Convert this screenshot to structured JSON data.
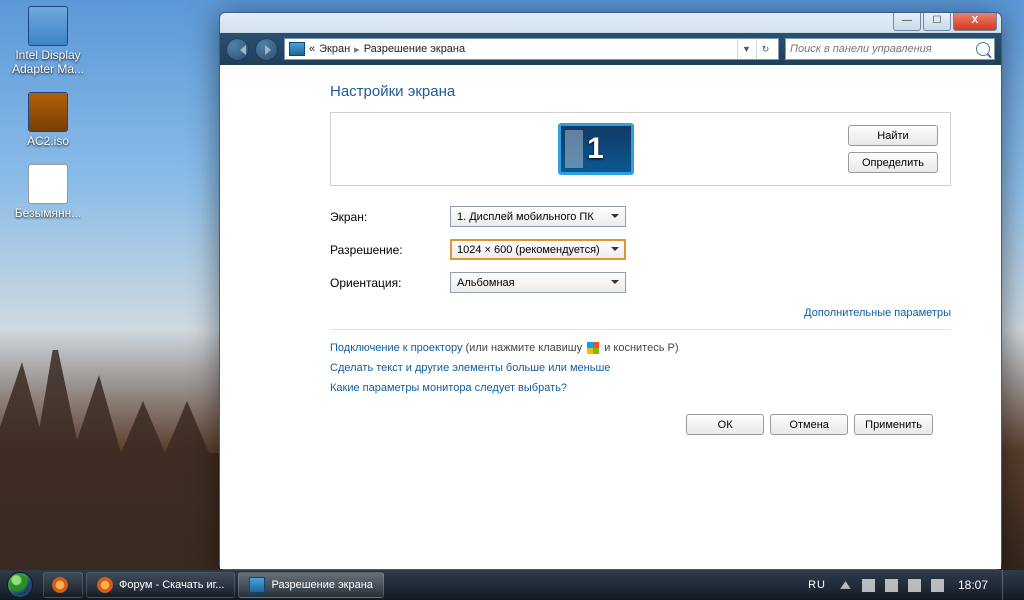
{
  "desktop": {
    "icons": [
      {
        "label": "Intel Display Adapter Ma..."
      },
      {
        "label": "AC2.iso"
      },
      {
        "label": "Безымянн..."
      }
    ]
  },
  "window": {
    "breadcrumb": {
      "part1": "Экран",
      "part2": "Разрешение экрана"
    },
    "search_placeholder": "Поиск в панели управления",
    "heading": "Настройки экрана",
    "buttons": {
      "find": "Найти",
      "identify": "Определить"
    },
    "monitor_number": "1",
    "fields": {
      "screen_label": "Экран:",
      "screen_value": "1. Дисплей мобильного ПК",
      "resolution_label": "Разрешение:",
      "resolution_value": "1024 × 600 (рекомендуется)",
      "orientation_label": "Ориентация:",
      "orientation_value": "Альбомная"
    },
    "advanced_link": "Дополнительные параметры",
    "projector_link": "Подключение к проектору",
    "projector_hint_a": " (или нажмите клавишу ",
    "projector_hint_b": " и коснитесь P)",
    "textsize_link": "Сделать текст и другие элементы больше или меньше",
    "whichmonitor_link": "Какие параметры монитора следует выбрать?",
    "footer": {
      "ok": "ОК",
      "cancel": "Отмена",
      "apply": "Применить"
    }
  },
  "taskbar": {
    "items": [
      {
        "label": "Форум - Скачать иг..."
      },
      {
        "label": "Разрешение экрана"
      }
    ],
    "lang": "RU",
    "clock": "18:07"
  }
}
